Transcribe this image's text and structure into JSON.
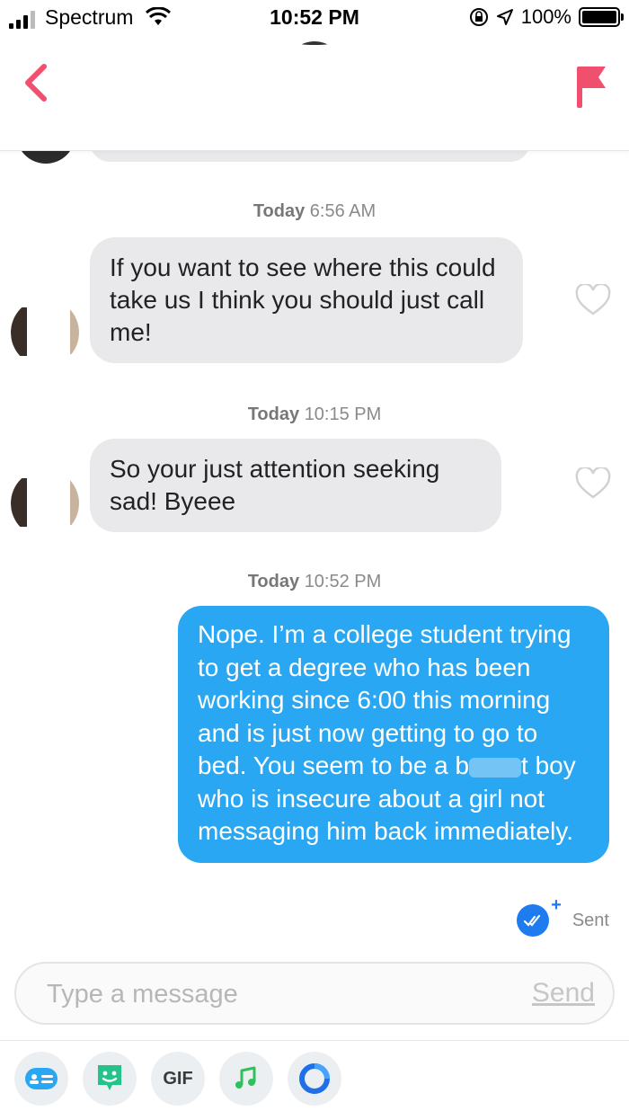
{
  "status_bar": {
    "carrier": "Spectrum",
    "time": "10:52 PM",
    "battery": "100%",
    "battery_level": 1.0
  },
  "header": {
    "accent_color": "#f0506e"
  },
  "messages": [
    {
      "timestamp_day": "Today",
      "timestamp_time": "6:56 AM",
      "direction": "incoming",
      "text": "If you want to see where this could take us I think you should just call me!"
    },
    {
      "timestamp_day": "Today",
      "timestamp_time": "10:15 PM",
      "direction": "incoming",
      "text": "So your just attention seeking sad! Byeee"
    },
    {
      "timestamp_day": "Today",
      "timestamp_time": "10:52 PM",
      "direction": "outgoing",
      "text_before_redaction": "Nope. I’m a college student trying to get a degree who has been working since 6:00 this morning and is just now getting to go to bed. You seem to be a b",
      "text_after_redaction": "t boy who is insecure about a girl not messaging him back immediately."
    }
  ],
  "sent_status": "Sent",
  "composer": {
    "placeholder": "Type a message",
    "send_label": "Send"
  },
  "toolbar": {
    "gif_label": "GIF",
    "icons": [
      "contact-card-icon",
      "sticker-icon",
      "gif-icon",
      "music-icon",
      "loop-icon"
    ]
  },
  "colors": {
    "outgoing_bubble": "#2aa7f2",
    "incoming_bubble": "#e9e9eb",
    "brand_red": "#f0506e",
    "read_receipt": "#1e7cf0"
  }
}
